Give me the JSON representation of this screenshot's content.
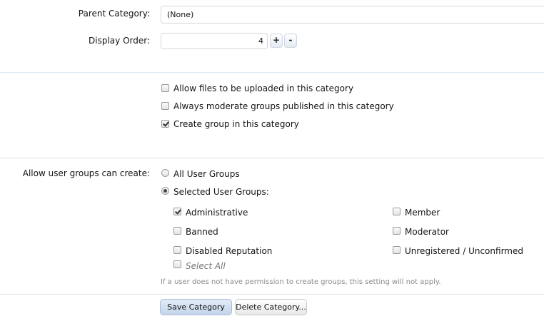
{
  "fields": {
    "parent_category_label": "Parent Category:",
    "parent_category_value": "(None)",
    "display_order_label": "Display Order:",
    "display_order_value": "4",
    "plus": "+",
    "minus": "-"
  },
  "options": {
    "allow_uploads": {
      "label": "Allow files to be uploaded in this category",
      "checked": false
    },
    "always_moderate": {
      "label": "Always moderate groups published in this category",
      "checked": false
    },
    "create_group": {
      "label": "Create group in this category",
      "checked": true
    }
  },
  "user_groups": {
    "label": "Allow user groups can create:",
    "all_label": "All User Groups",
    "selected_label": "Selected User Groups:",
    "selected_mode": "selected",
    "groups": [
      {
        "label": "Administrative",
        "checked": true
      },
      {
        "label": "Member",
        "checked": false
      },
      {
        "label": "Banned",
        "checked": false
      },
      {
        "label": "Moderator",
        "checked": false
      },
      {
        "label": "Disabled Reputation",
        "checked": false
      },
      {
        "label": "Unregistered / Unconfirmed",
        "checked": false
      }
    ],
    "select_all": "Select All",
    "hint": "If a user does not have permission to create groups, this setting will not apply."
  },
  "actions": {
    "save": "Save Category",
    "delete": "Delete Category..."
  }
}
